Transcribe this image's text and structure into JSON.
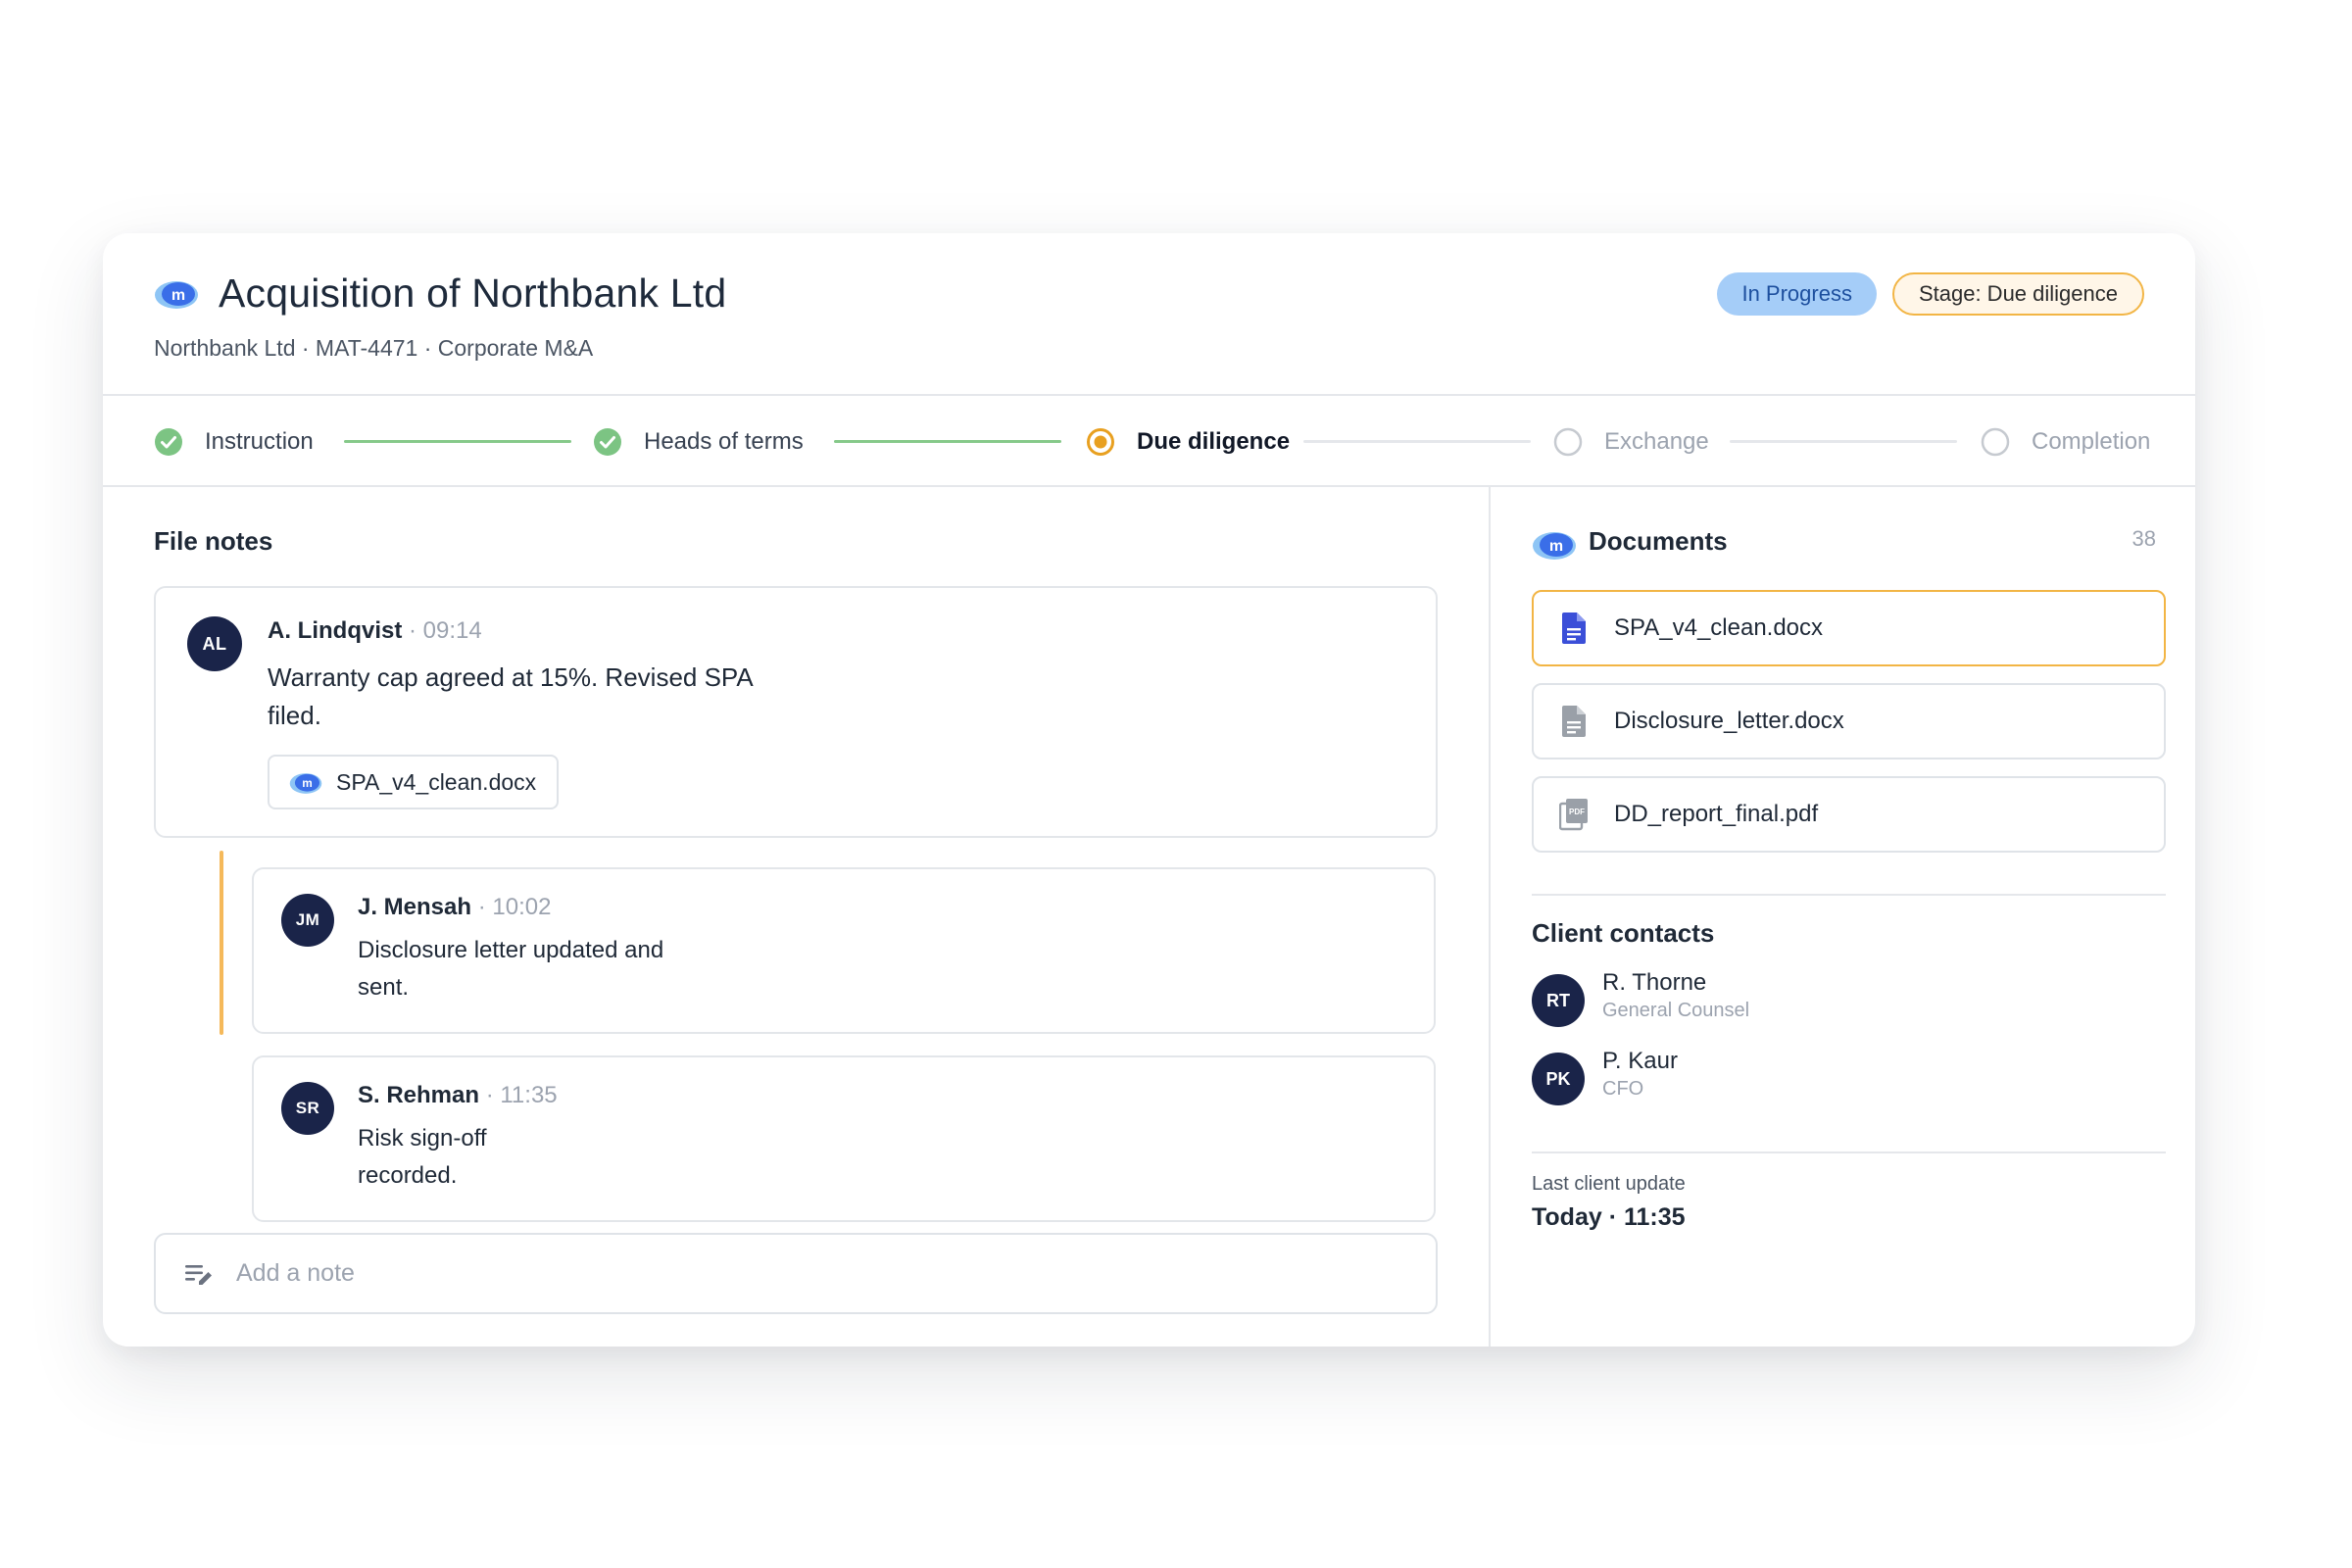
{
  "matter": {
    "title": "Acquisition of Northbank Ltd",
    "subtitle": "Northbank Ltd · MAT-4471 · Corporate M&A",
    "status_badge": "In Progress",
    "stage_badge": "Stage: Due diligence",
    "logo_icon": "m-cloud-logo-icon"
  },
  "stepper": {
    "steps": [
      {
        "label": "Instruction",
        "state": "done"
      },
      {
        "label": "Heads of terms",
        "state": "done"
      },
      {
        "label": "Due diligence",
        "state": "current"
      },
      {
        "label": "Exchange",
        "state": "todo"
      },
      {
        "label": "Completion",
        "state": "todo"
      }
    ]
  },
  "file_notes": {
    "title": "File notes",
    "notes": [
      {
        "initials": "AL",
        "author": "A. Lindqvist",
        "time": "· 09:14",
        "text_line1": "Warranty cap agreed at 15%. Revised SPA",
        "text_line2": "filed.",
        "attachment": "SPA_v4_clean.docx"
      }
    ],
    "replies": [
      {
        "initials": "JM",
        "author": "J. Mensah",
        "time": "· 10:02",
        "text_line1": "Disclosure letter updated and",
        "text_line2": "sent."
      },
      {
        "initials": "SR",
        "author": "S. Rehman",
        "time": "· 11:35",
        "text_line1": "Risk sign-off",
        "text_line2": "recorded."
      }
    ],
    "add_note_placeholder": "Add a note"
  },
  "documents": {
    "title": "Documents",
    "count": "38",
    "items": [
      {
        "name": "SPA_v4_clean.docx",
        "icon": "doc-blue-icon",
        "selected": true
      },
      {
        "name": "Disclosure_letter.docx",
        "icon": "doc-gray-icon",
        "selected": false
      },
      {
        "name": "DD_report_final.pdf",
        "icon": "pdf-icon",
        "selected": false
      }
    ]
  },
  "client_contacts": {
    "title": "Client contacts",
    "contacts": [
      {
        "initials": "RT",
        "name": "R. Thorne",
        "role": "General Counsel"
      },
      {
        "initials": "PK",
        "name": "P. Kaur",
        "role": "CFO"
      }
    ]
  },
  "last_update": {
    "label": "Last client update",
    "value": "Today · 11:35"
  },
  "colors": {
    "accent_orange": "#f2b545",
    "done_green": "#6cbf72",
    "navy_avatar": "#1a2449",
    "badge_blue": "#a5cdf8",
    "doc_blue": "#3b4fd8"
  }
}
